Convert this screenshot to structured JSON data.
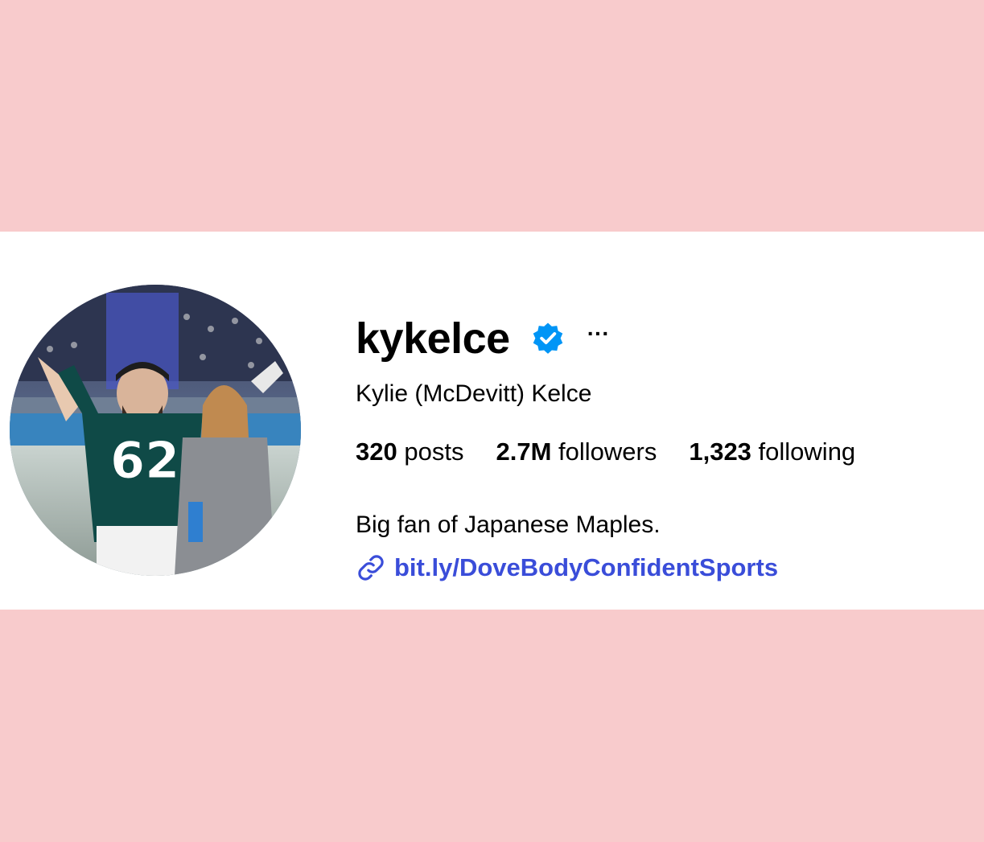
{
  "profile": {
    "username": "kykelce",
    "verified": true,
    "more_label": "···",
    "full_name": "Kylie (McDevitt) Kelce",
    "stats": {
      "posts_count": "320",
      "posts_label": "posts",
      "followers_count": "2.7M",
      "followers_label": "followers",
      "following_count": "1,323",
      "following_label": "following"
    },
    "bio": "Big fan of Japanese Maples.",
    "link": "bit.ly/DoveBodyConfidentSports"
  },
  "icons": {
    "verified": "verified-badge-icon",
    "link": "link-icon",
    "more": "more-options-icon"
  },
  "colors": {
    "background": "#f8cbcc",
    "card": "#ffffff",
    "verified_blue": "#0095f6",
    "link_blue": "#3a4dd9"
  }
}
